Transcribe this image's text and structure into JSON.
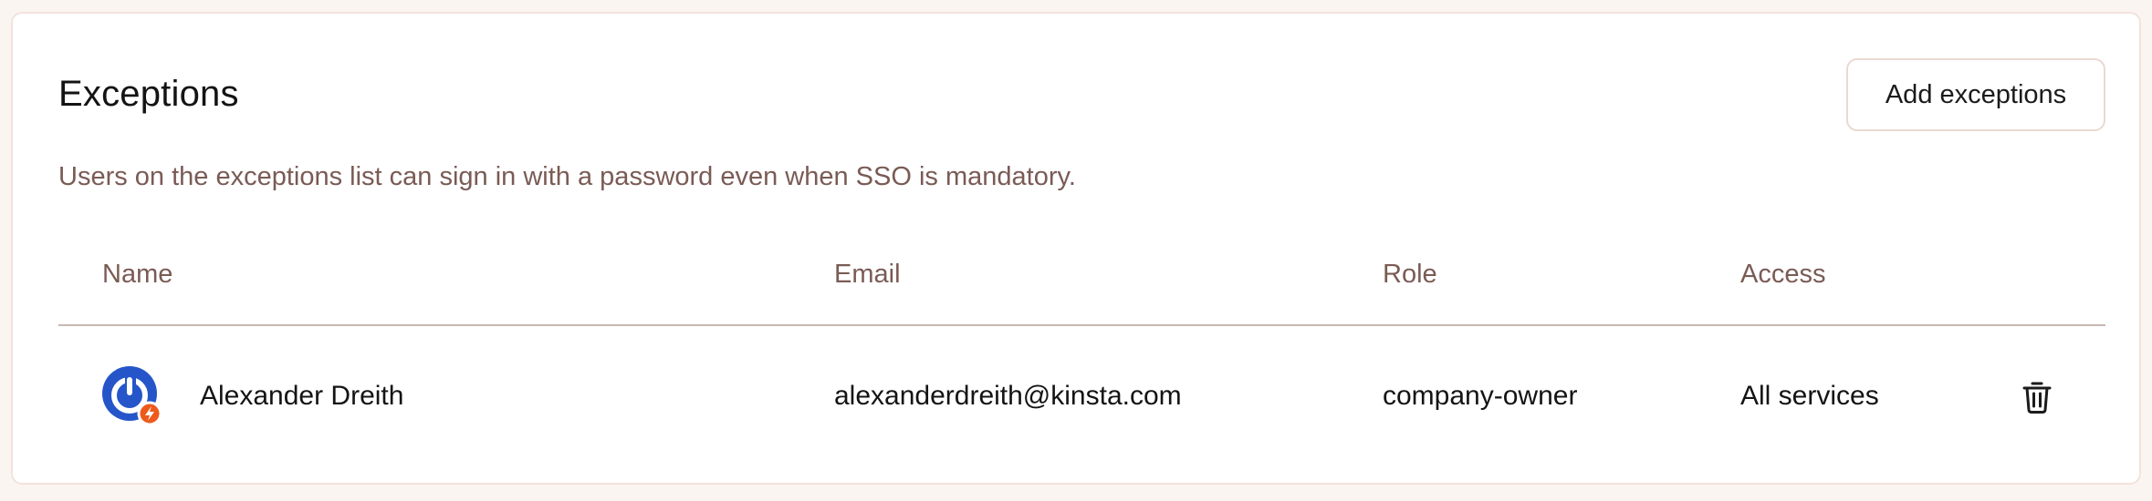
{
  "section": {
    "title": "Exceptions",
    "add_button_label": "Add exceptions",
    "description": "Users on the exceptions list can sign in with a password even when SSO is mandatory."
  },
  "table": {
    "columns": [
      "Name",
      "Email",
      "Role",
      "Access"
    ],
    "rows": [
      {
        "avatar_icon": "power-logo-avatar",
        "name": "Alexander Dreith",
        "email": "alexanderdreith@kinsta.com",
        "role": "company-owner",
        "access": "All services",
        "action_icon": "trash-icon"
      }
    ]
  },
  "colors": {
    "accent_blue": "#2555c9",
    "badge_orange": "#ee5a1c",
    "muted_text": "#7a5b55",
    "card_border": "#f3e2dc"
  }
}
